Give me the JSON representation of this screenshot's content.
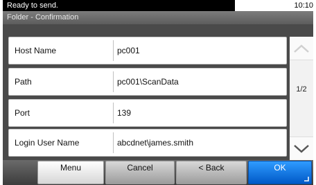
{
  "status": {
    "message": "Ready to send.",
    "time": "10:10"
  },
  "title": "Folder - Confirmation",
  "fields": [
    {
      "label": "Host Name",
      "value": "pc001"
    },
    {
      "label": "Path",
      "value": "pc001\\ScanData"
    },
    {
      "label": "Port",
      "value": "139"
    },
    {
      "label": "Login User Name",
      "value": "abcdnet\\james.smith"
    }
  ],
  "pager": {
    "indicator": "1/2",
    "up_icon": "chevron-up-icon",
    "down_icon": "chevron-down-icon"
  },
  "buttons": {
    "menu": "Menu",
    "cancel": "Cancel",
    "back": "< Back",
    "ok": "OK"
  },
  "colors": {
    "ok_button": "#1a7ee6",
    "panel": "#4a4a4a",
    "title_bar": "#6b6b6b"
  }
}
